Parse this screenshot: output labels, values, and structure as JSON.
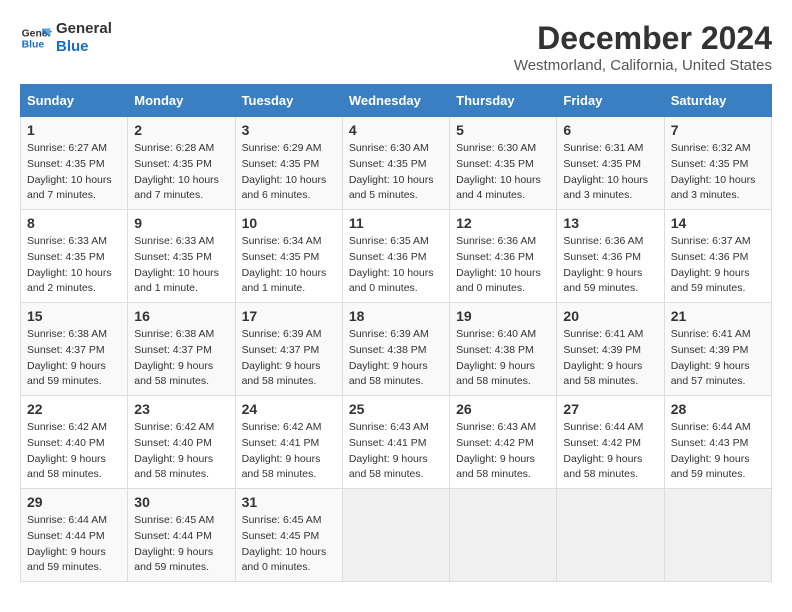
{
  "logo": {
    "line1": "General",
    "line2": "Blue"
  },
  "title": "December 2024",
  "subtitle": "Westmorland, California, United States",
  "days_of_week": [
    "Sunday",
    "Monday",
    "Tuesday",
    "Wednesday",
    "Thursday",
    "Friday",
    "Saturday"
  ],
  "weeks": [
    [
      {
        "day": "1",
        "sunrise": "6:27 AM",
        "sunset": "4:35 PM",
        "daylight": "10 hours and 7 minutes."
      },
      {
        "day": "2",
        "sunrise": "6:28 AM",
        "sunset": "4:35 PM",
        "daylight": "10 hours and 7 minutes."
      },
      {
        "day": "3",
        "sunrise": "6:29 AM",
        "sunset": "4:35 PM",
        "daylight": "10 hours and 6 minutes."
      },
      {
        "day": "4",
        "sunrise": "6:30 AM",
        "sunset": "4:35 PM",
        "daylight": "10 hours and 5 minutes."
      },
      {
        "day": "5",
        "sunrise": "6:30 AM",
        "sunset": "4:35 PM",
        "daylight": "10 hours and 4 minutes."
      },
      {
        "day": "6",
        "sunrise": "6:31 AM",
        "sunset": "4:35 PM",
        "daylight": "10 hours and 3 minutes."
      },
      {
        "day": "7",
        "sunrise": "6:32 AM",
        "sunset": "4:35 PM",
        "daylight": "10 hours and 3 minutes."
      }
    ],
    [
      {
        "day": "8",
        "sunrise": "6:33 AM",
        "sunset": "4:35 PM",
        "daylight": "10 hours and 2 minutes."
      },
      {
        "day": "9",
        "sunrise": "6:33 AM",
        "sunset": "4:35 PM",
        "daylight": "10 hours and 1 minute."
      },
      {
        "day": "10",
        "sunrise": "6:34 AM",
        "sunset": "4:35 PM",
        "daylight": "10 hours and 1 minute."
      },
      {
        "day": "11",
        "sunrise": "6:35 AM",
        "sunset": "4:36 PM",
        "daylight": "10 hours and 0 minutes."
      },
      {
        "day": "12",
        "sunrise": "6:36 AM",
        "sunset": "4:36 PM",
        "daylight": "10 hours and 0 minutes."
      },
      {
        "day": "13",
        "sunrise": "6:36 AM",
        "sunset": "4:36 PM",
        "daylight": "9 hours and 59 minutes."
      },
      {
        "day": "14",
        "sunrise": "6:37 AM",
        "sunset": "4:36 PM",
        "daylight": "9 hours and 59 minutes."
      }
    ],
    [
      {
        "day": "15",
        "sunrise": "6:38 AM",
        "sunset": "4:37 PM",
        "daylight": "9 hours and 59 minutes."
      },
      {
        "day": "16",
        "sunrise": "6:38 AM",
        "sunset": "4:37 PM",
        "daylight": "9 hours and 58 minutes."
      },
      {
        "day": "17",
        "sunrise": "6:39 AM",
        "sunset": "4:37 PM",
        "daylight": "9 hours and 58 minutes."
      },
      {
        "day": "18",
        "sunrise": "6:39 AM",
        "sunset": "4:38 PM",
        "daylight": "9 hours and 58 minutes."
      },
      {
        "day": "19",
        "sunrise": "6:40 AM",
        "sunset": "4:38 PM",
        "daylight": "9 hours and 58 minutes."
      },
      {
        "day": "20",
        "sunrise": "6:41 AM",
        "sunset": "4:39 PM",
        "daylight": "9 hours and 58 minutes."
      },
      {
        "day": "21",
        "sunrise": "6:41 AM",
        "sunset": "4:39 PM",
        "daylight": "9 hours and 57 minutes."
      }
    ],
    [
      {
        "day": "22",
        "sunrise": "6:42 AM",
        "sunset": "4:40 PM",
        "daylight": "9 hours and 58 minutes."
      },
      {
        "day": "23",
        "sunrise": "6:42 AM",
        "sunset": "4:40 PM",
        "daylight": "9 hours and 58 minutes."
      },
      {
        "day": "24",
        "sunrise": "6:42 AM",
        "sunset": "4:41 PM",
        "daylight": "9 hours and 58 minutes."
      },
      {
        "day": "25",
        "sunrise": "6:43 AM",
        "sunset": "4:41 PM",
        "daylight": "9 hours and 58 minutes."
      },
      {
        "day": "26",
        "sunrise": "6:43 AM",
        "sunset": "4:42 PM",
        "daylight": "9 hours and 58 minutes."
      },
      {
        "day": "27",
        "sunrise": "6:44 AM",
        "sunset": "4:42 PM",
        "daylight": "9 hours and 58 minutes."
      },
      {
        "day": "28",
        "sunrise": "6:44 AM",
        "sunset": "4:43 PM",
        "daylight": "9 hours and 59 minutes."
      }
    ],
    [
      {
        "day": "29",
        "sunrise": "6:44 AM",
        "sunset": "4:44 PM",
        "daylight": "9 hours and 59 minutes."
      },
      {
        "day": "30",
        "sunrise": "6:45 AM",
        "sunset": "4:44 PM",
        "daylight": "9 hours and 59 minutes."
      },
      {
        "day": "31",
        "sunrise": "6:45 AM",
        "sunset": "4:45 PM",
        "daylight": "10 hours and 0 minutes."
      },
      null,
      null,
      null,
      null
    ]
  ],
  "labels": {
    "sunrise": "Sunrise:",
    "sunset": "Sunset:",
    "daylight": "Daylight:"
  }
}
